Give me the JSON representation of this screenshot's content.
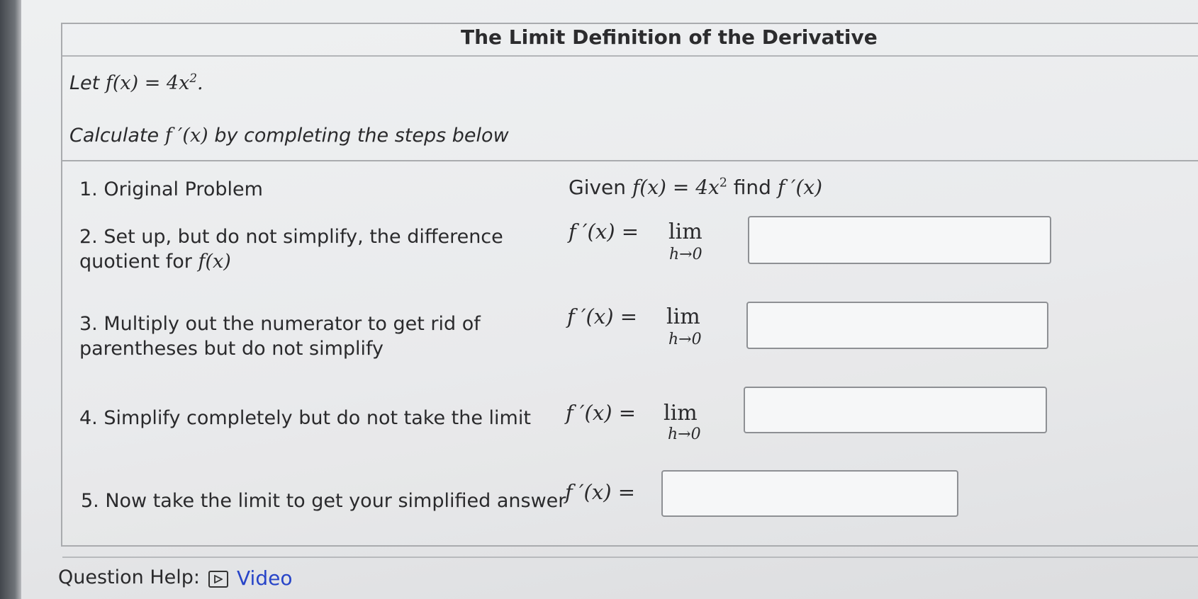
{
  "title": "The Limit Definition of the Derivative",
  "intro": {
    "let_prefix": "Let",
    "function": "f(x) = 4x",
    "function_exp": "2",
    "function_end": ".",
    "calc_prefix": "Calculate",
    "calc_expr": "f ′(x)",
    "calc_suffix": "by completing the steps below"
  },
  "steps": [
    {
      "line1": "1. Original Problem",
      "line2": ""
    },
    {
      "line1": "2. Set up, but do not simplify, the difference",
      "line2_text": "quotient for",
      "line2_math": "f(x)"
    },
    {
      "line1": "3. Multiply out the numerator to get rid of",
      "line2": "parentheses but do not simplify"
    },
    {
      "line1": "4. Simplify completely but do not take the limit"
    },
    {
      "line1": "5. Now take the limit to get your simplified answer"
    }
  ],
  "given": {
    "word1": "Given",
    "expr": "f(x) = 4x",
    "exp": "2",
    "word2": "find",
    "target": "f ′(x)"
  },
  "equations": {
    "lhs": "f ′(x) =",
    "lim": "lim",
    "lim_sub": "h→0"
  },
  "inputs": {
    "step2": "",
    "step3": "",
    "step4": "",
    "step5": ""
  },
  "help": {
    "label": "Question Help:",
    "video": "Video"
  },
  "icons": {
    "video": "play-icon"
  },
  "colors": {
    "link": "#2845c8",
    "border": "#a9abae"
  }
}
